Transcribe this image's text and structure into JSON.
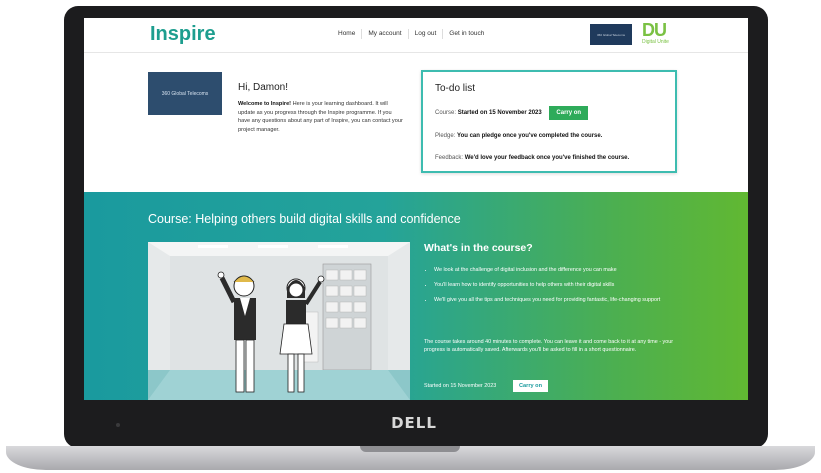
{
  "brand": {
    "name": "Inspire",
    "color": "#1e9e8f"
  },
  "nav": {
    "links": [
      "Home",
      "My account",
      "Log out",
      "Get in touch"
    ]
  },
  "partner_logo": {
    "text": "360 Global Telecoms"
  },
  "du_logo": {
    "mark": "DU",
    "text": "Digital Unite"
  },
  "org_logo": {
    "text": "360 Global Telecoms"
  },
  "welcome": {
    "greeting": "Hi, Damon!",
    "intro_bold": "Welcome to Inspire!",
    "intro_rest": " Here is your learning dashboard. It will update as you progress through the Inspire programme. If you have any questions about any part of Inspire, you can contact your project manager."
  },
  "todo": {
    "title": "To-do list",
    "course_label": "Course:",
    "course_status": "Started on 15 November 2023",
    "course_button": "Carry on",
    "pledge_label": "Pledge:",
    "pledge_text": "You can pledge once you've completed the course.",
    "feedback_label": "Feedback:",
    "feedback_text": "We'd love your feedback once you've finished the course."
  },
  "course": {
    "title": "Course: Helping others build digital skills and confidence",
    "whats_in": "What's in the course?",
    "bullets": [
      "We look at the challenge of digital inclusion and the difference you can make",
      "You'll learn how to identify opportunities to help others with their digital skills",
      "We'll give you all the tips and techniques you need for providing fantastic, life-changing support"
    ],
    "paragraph": "The course takes around 40 minutes to complete. You can leave it and come back to it at any time - your progress is automatically saved. Afterwards you'll be asked to fill in a short questionnaire.",
    "started": "Started on 15 November 2023",
    "button": "Carry on"
  },
  "device": {
    "brand": "DELL"
  },
  "colors": {
    "teal": "#1a9a9e",
    "green": "#61b832",
    "button_green": "#2eab5a"
  }
}
